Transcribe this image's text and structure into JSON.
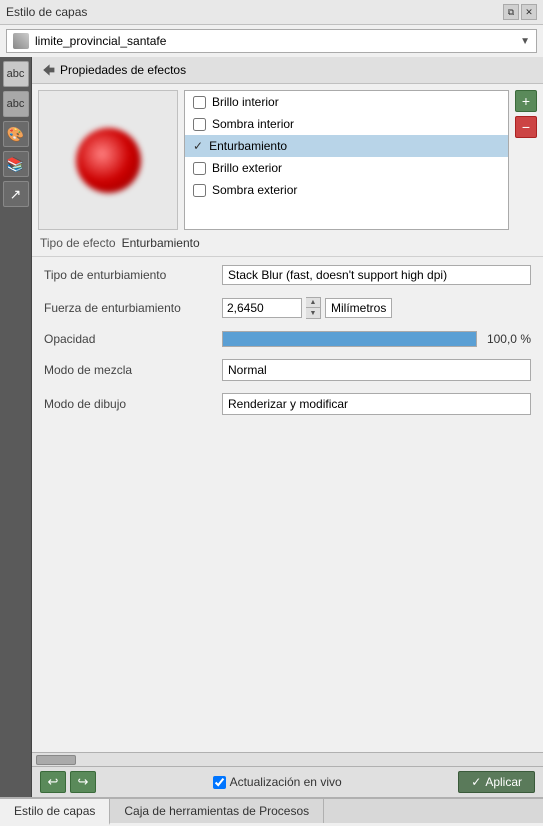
{
  "window": {
    "title": "Estilo de capas"
  },
  "layer": {
    "name": "limite_provincial_santafe",
    "icon": "layer-icon"
  },
  "properties_header": {
    "title": "Propiedades de efectos",
    "back_icon": "back-arrow"
  },
  "effects_list": {
    "items": [
      {
        "label": "Brillo interior",
        "checked": false,
        "selected": false
      },
      {
        "label": "Sombra interior",
        "checked": false,
        "selected": false
      },
      {
        "label": "Enturbamiento",
        "checked": true,
        "selected": true
      },
      {
        "label": "Brillo exterior",
        "checked": false,
        "selected": false
      },
      {
        "label": "Sombra exterior",
        "checked": false,
        "selected": false
      }
    ]
  },
  "buttons": {
    "add": "+",
    "remove": "−",
    "undo": "↩",
    "redo": "↪",
    "apply": "Aplicar",
    "checkmark": "✓"
  },
  "effect_type": {
    "label": "Tipo de efecto",
    "value": "Enturbamiento"
  },
  "form": {
    "blur_type_label": "Tipo de enturbiamiento",
    "blur_type_value": "Stack Blur (fast, doesn't support high dpi)",
    "force_label": "Fuerza de enturbiamiento",
    "force_value": "2,6450",
    "force_unit": "Milímetros",
    "opacity_label": "Opacidad",
    "opacity_value": "100,0 %",
    "opacity_percent": 100,
    "blend_label": "Modo de mezcla",
    "blend_value": "Normal",
    "draw_label": "Modo de dibujo",
    "draw_value": "Renderizar y modificar"
  },
  "bottom": {
    "live_update_label": "Actualización en vivo",
    "live_update_checked": true,
    "apply_label": "Aplicar"
  },
  "tabs": [
    {
      "label": "Estilo de capas",
      "active": true
    },
    {
      "label": "Caja de herramientas de Procesos",
      "active": false
    }
  ]
}
